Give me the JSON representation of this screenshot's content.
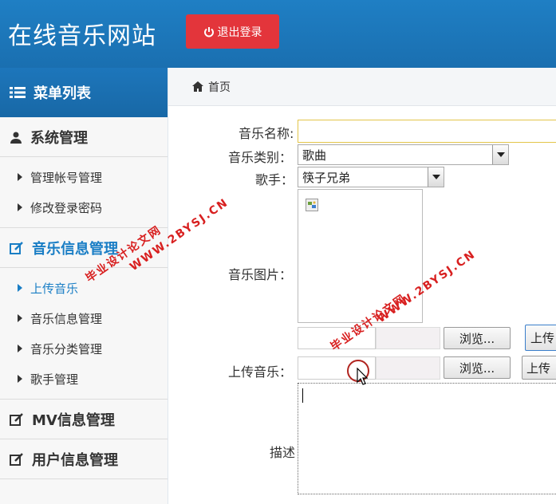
{
  "header": {
    "title": "在线音乐网站",
    "logout_label": "退出登录"
  },
  "sidebar": {
    "menu_title": "菜单列表",
    "groups": [
      {
        "label": "系统管理",
        "items": [
          "管理帐号管理",
          "修改登录密码"
        ]
      },
      {
        "label": "音乐信息管理",
        "items": [
          "上传音乐",
          "音乐信息管理",
          "音乐分类管理",
          "歌手管理"
        ]
      },
      {
        "label": "MV信息管理"
      },
      {
        "label": "用户信息管理"
      }
    ]
  },
  "breadcrumb": {
    "home": "首页"
  },
  "form": {
    "name_label": "音乐名称:",
    "name_value": "",
    "category_label": "音乐类别：",
    "category_value": "歌曲",
    "singer_label": "歌手：",
    "singer_value": "筷子兄弟",
    "image_label": "音乐图片：",
    "browse_label": "浏览...",
    "upload_label": "上传",
    "music_label": "上传音乐：",
    "upload_label_2": "上传",
    "desc_label": "描述"
  },
  "watermarks": [
    "毕业设计论文网",
    "WWW.2BYSJ.CN"
  ],
  "colors": {
    "header": "#1f7fc4",
    "accent": "#1a7ec5",
    "logout": "#e3353b",
    "watermark": "#d82020"
  }
}
